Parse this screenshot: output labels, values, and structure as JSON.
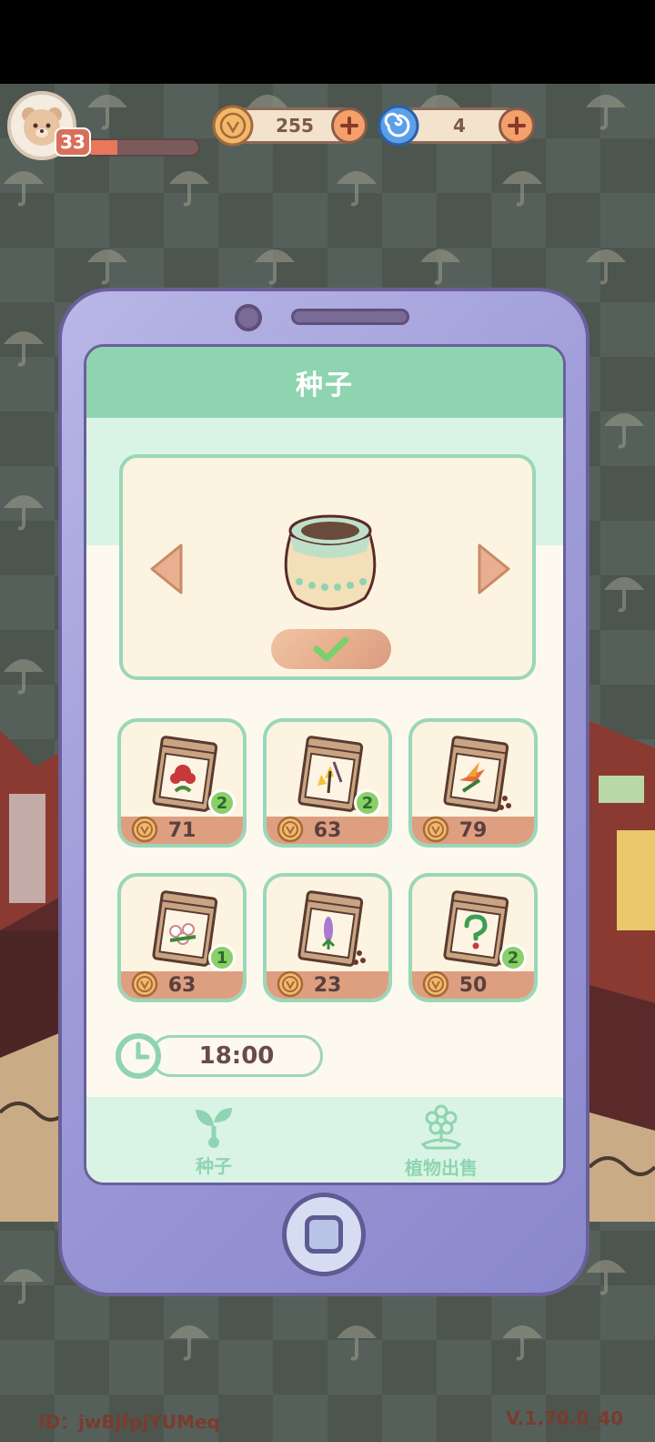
{
  "hud": {
    "level": "33",
    "xp_progress": 0.28,
    "coins": "255",
    "gems": "4"
  },
  "screen": {
    "title": "种子",
    "seeds": [
      {
        "price": "71",
        "count": "2",
        "flower": "red-rose-icon"
      },
      {
        "price": "63",
        "count": "2",
        "flower": "yellow-lily-icon"
      },
      {
        "price": "79",
        "count": "",
        "flower": "bird-of-paradise-icon"
      },
      {
        "price": "63",
        "count": "1",
        "flower": "white-flower-bouquet-icon"
      },
      {
        "price": "23",
        "count": "",
        "flower": "lavender-icon"
      },
      {
        "price": "50",
        "count": "2",
        "flower": "question-mark-icon"
      }
    ],
    "timer": "18:00",
    "tabs": [
      {
        "label": "种子",
        "icon": "sprout-icon"
      },
      {
        "label": "植物出售",
        "icon": "flower-icon"
      }
    ]
  },
  "footer": {
    "id_text": "ID：jwBjfpjYUMeq",
    "version": "V.1.70.0_40"
  },
  "colors": {
    "header": "#8fd4b0",
    "price_band": "#dd9f80",
    "badge": "#8ad06a",
    "phone": "#9e9bd8"
  }
}
